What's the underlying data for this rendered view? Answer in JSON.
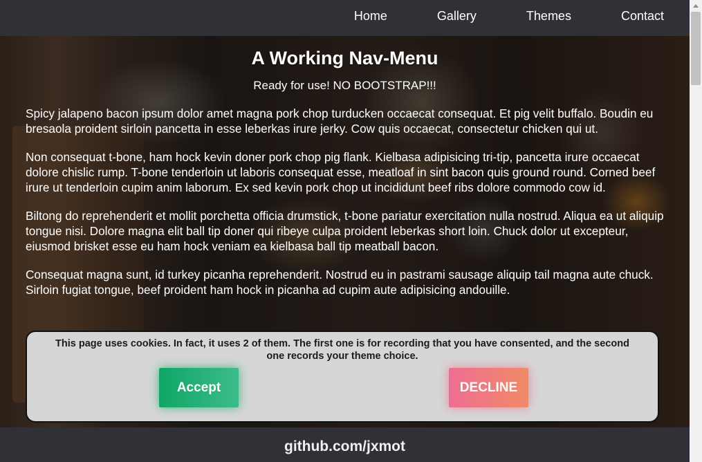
{
  "nav": {
    "items": [
      {
        "label": "Home"
      },
      {
        "label": "Gallery"
      },
      {
        "label": "Themes"
      },
      {
        "label": "Contact"
      }
    ]
  },
  "main": {
    "title": "A Working Nav-Menu",
    "subtitle": "Ready for use! NO BOOTSTRAP!!!",
    "paragraphs": [
      "Spicy jalapeno bacon ipsum dolor amet magna pork chop turducken occaecat consequat. Et pig velit buffalo. Boudin eu bresaola proident sirloin pancetta in esse leberkas irure jerky. Cow quis occaecat, consectetur chicken qui ut.",
      "Non consequat t-bone, ham hock kevin doner pork chop pig flank. Kielbasa adipisicing tri-tip, pancetta irure occaecat dolore chislic rump. T-bone tenderloin ut laboris consequat esse, meatloaf in sint bacon quis ground round. Corned beef irure ut tenderloin cupim anim laborum. Ex sed kevin pork chop ut incididunt beef ribs dolore commodo cow id.",
      "Biltong do reprehenderit et mollit porchetta officia drumstick, t-bone pariatur exercitation nulla nostrud. Aliqua ea ut aliquip tongue nisi. Dolore magna elit ball tip doner qui ribeye culpa proident leberkas short loin. Chuck dolor ut excepteur, eiusmod brisket esse eu ham hock veniam ea kielbasa ball tip meatball bacon.",
      "Consequat magna sunt, id turkey picanha reprehenderit. Nostrud eu in pastrami sausage aliquip tail magna aute chuck. Sirloin fugiat tongue, beef proident ham hock in picanha ad cupim aute adipisicing andouille."
    ]
  },
  "cookie_banner": {
    "message": "This page uses cookies. In fact, it uses 2 of them. The first one is for recording that you have consented, and the second one records your theme choice.",
    "accept_label": "Accept",
    "decline_label": "DECLINE"
  },
  "footer": {
    "text": "github.com/jxmot"
  },
  "colors": {
    "header_bg": "#2f3136",
    "accept": "#0fa666",
    "decline": "#ee6d93",
    "banner_bg": "#d6d6d6"
  }
}
